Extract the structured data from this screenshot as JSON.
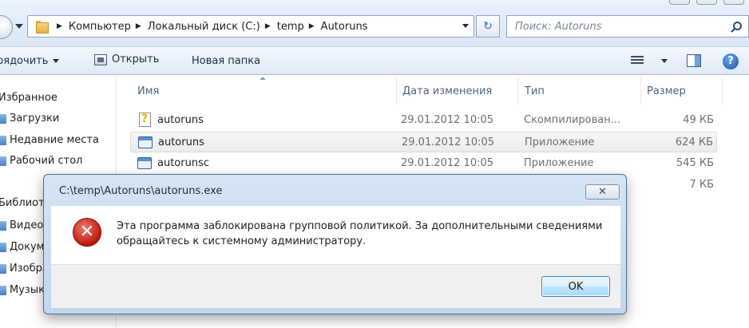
{
  "address_bar": {
    "crumbs": [
      "Компьютер",
      "Локальный диск (C:)",
      "temp",
      "Autoruns"
    ],
    "search_placeholder": "Поиск: Autoruns"
  },
  "command_bar": {
    "organize_label": "рядочить",
    "open_label": "Открыть",
    "new_folder_label": "Новая папка"
  },
  "nav_pane": {
    "favorites_header": "Избранное",
    "favorites": [
      "Загрузки",
      "Недавние места",
      "Рабочий стол"
    ],
    "libraries_header": "Библиот",
    "libraries": [
      "Видео",
      "Докум",
      "Изобра",
      "Музык"
    ]
  },
  "file_list": {
    "columns": {
      "name": "Имя",
      "date": "Дата изменения",
      "type": "Тип",
      "size": "Размер"
    },
    "rows": [
      {
        "name": "autoruns",
        "date": "29.01.2012 10:05",
        "type": "Скомпилирован...",
        "size": "49 КБ",
        "icon": "help-file-icon"
      },
      {
        "name": "autoruns",
        "date": "29.01.2012 10:05",
        "type": "Приложение",
        "size": "624 КБ",
        "icon": "application-icon"
      },
      {
        "name": "autorunsc",
        "date": "29.01.2012 10:05",
        "type": "Приложение",
        "size": "545 КБ",
        "icon": "application-icon"
      },
      {
        "name": "",
        "date": "",
        "type": "",
        "size": "7 КБ",
        "icon": ""
      }
    ]
  },
  "dialog": {
    "title": "C:\\temp\\Autoruns\\autoruns.exe",
    "close_label": "✕",
    "message": "Эта программа заблокирована групповой политикой. За дополнительными сведениями обращайтесь к системному администратору.",
    "ok_label": "OK",
    "icon": "error-icon"
  }
}
